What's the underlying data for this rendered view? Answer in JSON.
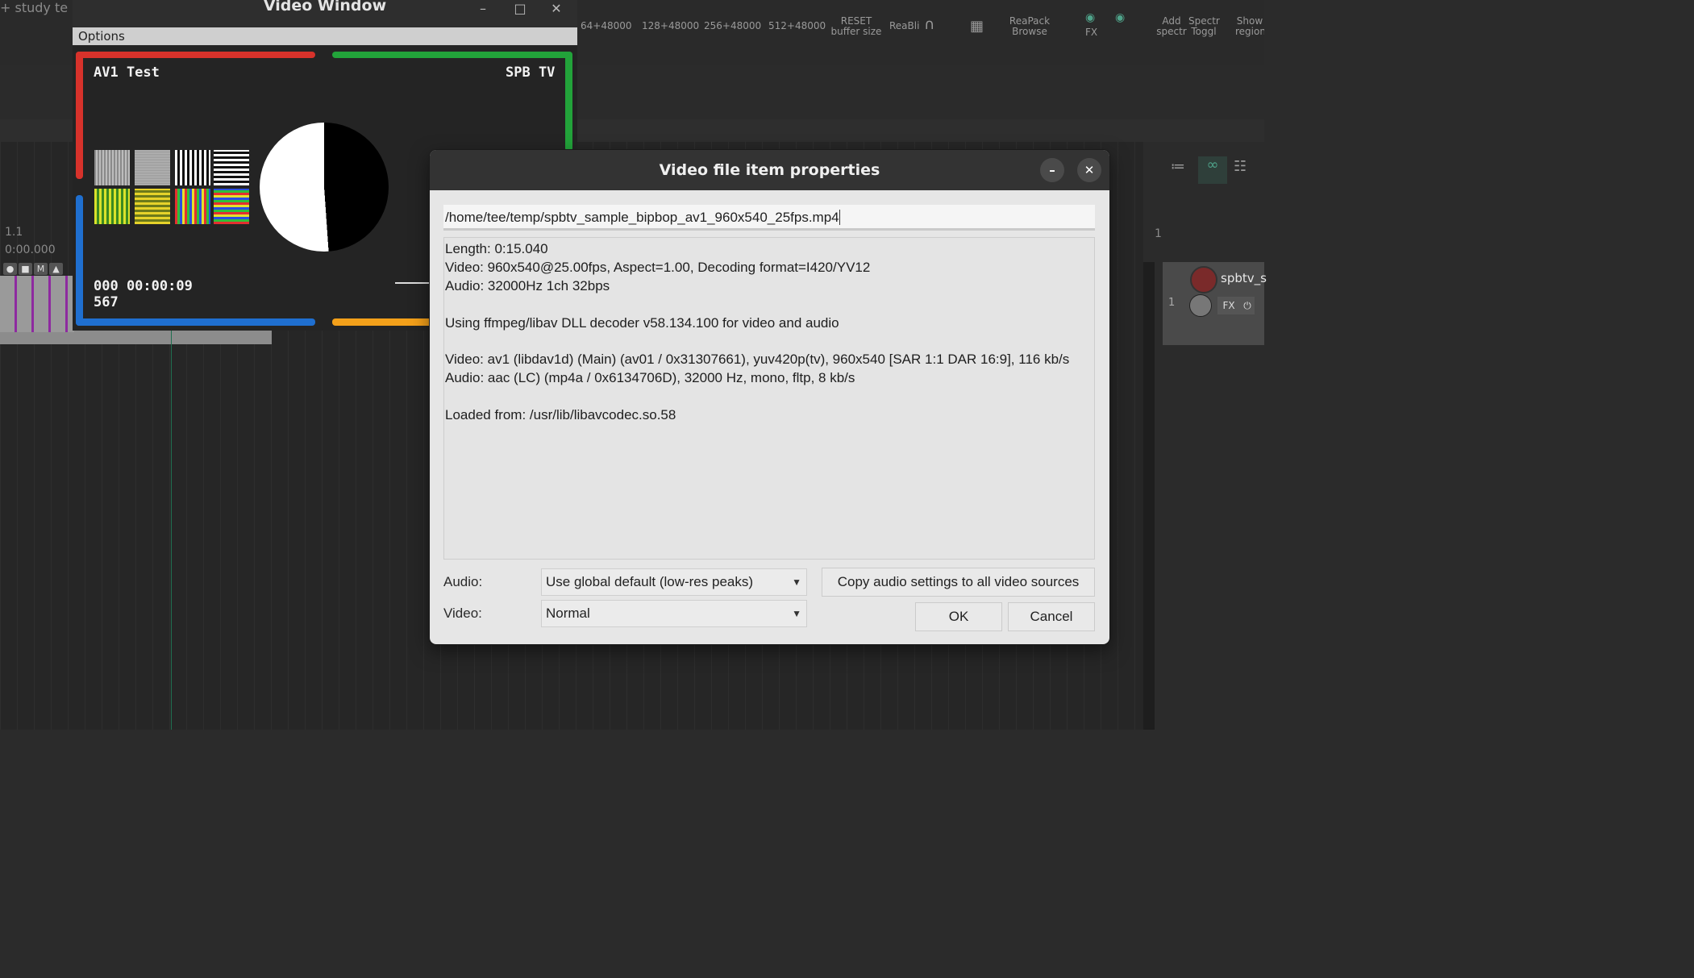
{
  "daw": {
    "tab_title": "study te",
    "toolbar_buttons": {
      "buf_64": "64+48000",
      "buf_128": "128+48000",
      "buf_256": "256+48000",
      "buf_512": "512+48000",
      "reset_buffer": "RESET buffer size",
      "reabl": "ReaBli",
      "reapack": "ReaPack Browse",
      "fx": "FX",
      "add_spectr": "Add spectr",
      "spectr_toggl": "Spectr Toggl",
      "show_region": "Show region"
    },
    "position_measure": "1.1",
    "position_time": "0:00.000",
    "track_buttons": [
      "M"
    ],
    "track_name": "spbtv_s",
    "track_number": "1",
    "fx_label": "FX",
    "right_ruler_mark": "1"
  },
  "video_window": {
    "title": "Video Window",
    "menu_options": "Options",
    "frame": {
      "title_left": "AV1 Test",
      "title_right": "SPB TV",
      "timecode": "000 00:00:09",
      "frame_number": "567"
    }
  },
  "dialog": {
    "title": "Video file item properties",
    "file_path": "/home/tee/temp/spbtv_sample_bipbop_av1_960x540_25fps.mp4",
    "info_lines": [
      "Length: 0:15.040",
      "Video: 960x540@25.00fps, Aspect=1.00, Decoding format=I420/YV12",
      "Audio: 32000Hz 1ch 32bps",
      "",
      "Using ffmpeg/libav DLL decoder v58.134.100 for video and audio",
      "",
      "Video: av1 (libdav1d) (Main) (av01 / 0x31307661), yuv420p(tv), 960x540 [SAR 1:1 DAR 16:9], 116 kb/s",
      "Audio: aac (LC) (mp4a / 0x6134706D), 32000 Hz, mono, fltp, 8 kb/s",
      "",
      "Loaded from: /usr/lib/libavcodec.so.58"
    ],
    "audio_label": "Audio:",
    "audio_value": "Use global default (low-res peaks)",
    "video_label": "Video:",
    "video_value": "Normal",
    "copy_button": "Copy audio settings to all video sources",
    "ok_button": "OK",
    "cancel_button": "Cancel"
  },
  "colors": {
    "bar_red": "#d7322b",
    "bar_green": "#22a33a",
    "bar_blue": "#1f6fd0",
    "bar_orange": "#f3a01a",
    "dialog_bg": "#e6e6e6",
    "titlebar": "#333333"
  }
}
